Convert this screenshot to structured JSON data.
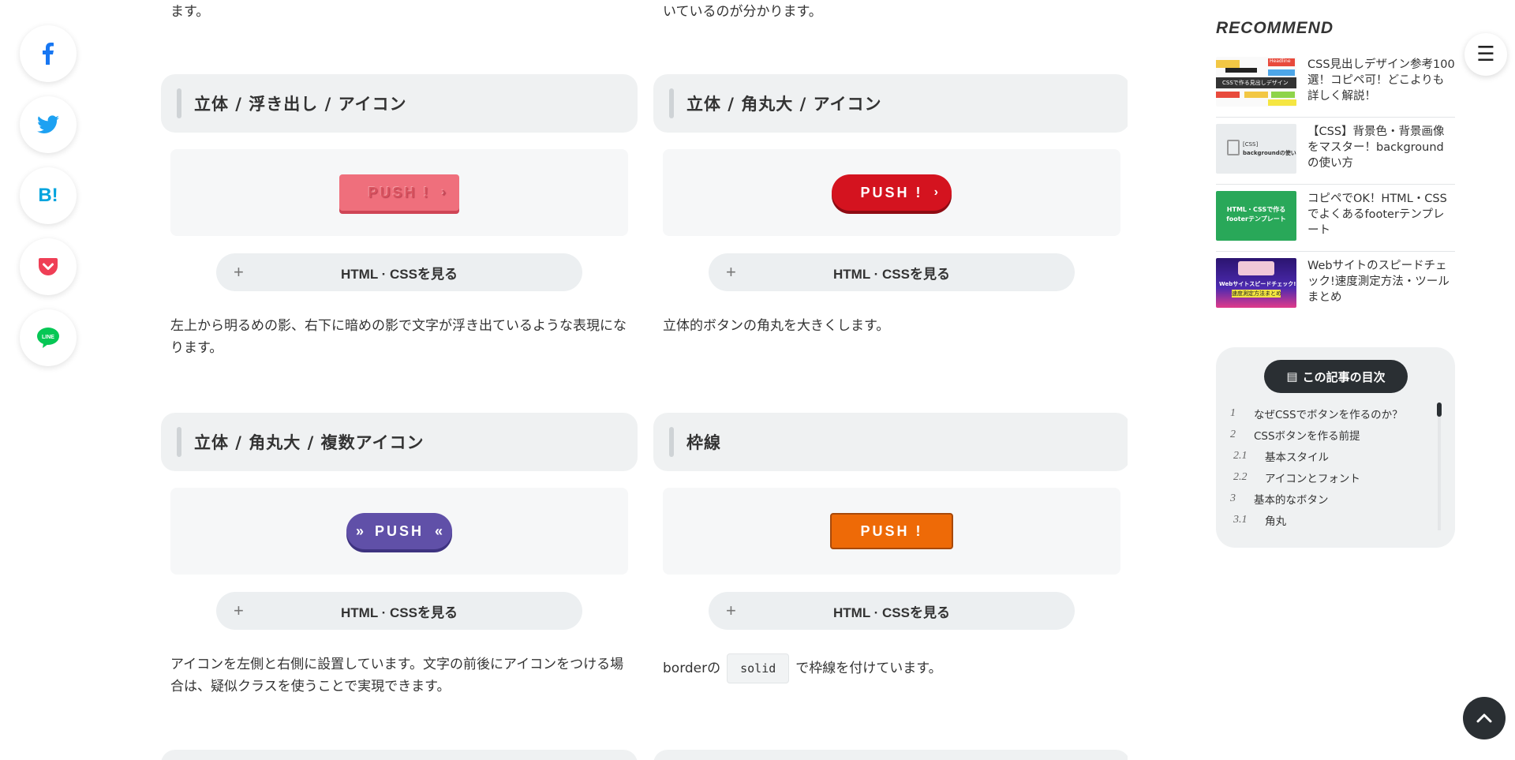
{
  "colors": {
    "facebook": "#1877f2",
    "twitter": "#1da1f2",
    "hatena": "#00a4de",
    "pocket": "#ef3f56",
    "line": "#06c755",
    "card_bg": "#eff1f2",
    "dark": "#2a2f33"
  },
  "share": {
    "hatena_label": "B!",
    "line_label": "LINE"
  },
  "intro": {
    "left": "ます。",
    "right": "いているのが分かります。"
  },
  "cards": [
    {
      "title": "立体 / 浮き出し / アイコン",
      "button_label": "PUSH !",
      "code_label": "HTML · CSSを見る",
      "description": "左上から明るめの影、右下に暗めの影で文字が浮き出ているような表現になります。"
    },
    {
      "title": "立体 / 角丸大 / アイコン",
      "button_label": "PUSH !",
      "code_label": "HTML · CSSを見る",
      "description": "立体的ボタンの角丸を大きくします。"
    },
    {
      "title": "立体 / 角丸大 / 複数アイコン",
      "button_label": "PUSH",
      "code_label": "HTML · CSSを見る",
      "description": "アイコンを左側と右側に設置しています。文字の前後にアイコンをつける場合は、疑似クラスを使うことで実現できます。"
    },
    {
      "title": "枠線",
      "button_label": "PUSH !",
      "code_label": "HTML · CSSを見る",
      "description_before": "borderの",
      "description_code": "solid",
      "description_after": "で枠線を付けています。"
    }
  ],
  "sidebar": {
    "recommend_title": "RECOMMEND",
    "items": [
      {
        "text": "CSS見出しデザイン参考100選！コピペ可！どこよりも詳しく解説！",
        "thumb_label": "CSSで作る見出しデザイン",
        "thumb_top": "Headline"
      },
      {
        "text": "【CSS】背景色・背景画像をマスター！backgroundの使い方",
        "thumb_label": "backgroundの使い方",
        "thumb_top": "[CSS]"
      },
      {
        "text": "コピペでOK！HTML・CSSでよくあるfooterテンプレート",
        "thumb_label": "HTML・CSSで作るfooterテンプレート"
      },
      {
        "text": "Webサイトのスピードチェック!速度測定方法・ツールまとめ",
        "thumb_label": "Webサイトスピードチェック!",
        "thumb_sub": "速度測定方法まとめ"
      }
    ],
    "toc": {
      "title": "この記事の目次",
      "rows": [
        {
          "num": "1",
          "text": "なぜCSSでボタンを作るのか？",
          "level": 1
        },
        {
          "num": "2",
          "text": "CSSボタンを作る前提",
          "level": 1
        },
        {
          "num": "2.1",
          "text": "基本スタイル",
          "level": 2
        },
        {
          "num": "2.2",
          "text": "アイコンとフォント",
          "level": 2
        },
        {
          "num": "3",
          "text": "基本的なボタン",
          "level": 1
        },
        {
          "num": "3.1",
          "text": "角丸",
          "level": 2
        }
      ]
    }
  }
}
